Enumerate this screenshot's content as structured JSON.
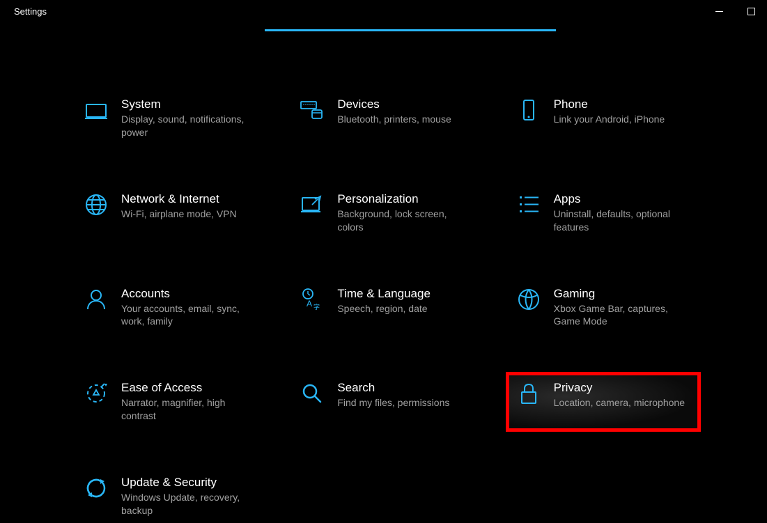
{
  "window": {
    "title": "Settings"
  },
  "accentColor": "#29b6f6",
  "highlightColor": "#ff0000",
  "categories": [
    {
      "icon": "system",
      "title": "System",
      "desc": "Display, sound, notifications, power",
      "highlighted": false
    },
    {
      "icon": "devices",
      "title": "Devices",
      "desc": "Bluetooth, printers, mouse",
      "highlighted": false
    },
    {
      "icon": "phone",
      "title": "Phone",
      "desc": "Link your Android, iPhone",
      "highlighted": false
    },
    {
      "icon": "network",
      "title": "Network & Internet",
      "desc": "Wi-Fi, airplane mode, VPN",
      "highlighted": false
    },
    {
      "icon": "personalization",
      "title": "Personalization",
      "desc": "Background, lock screen, colors",
      "highlighted": false
    },
    {
      "icon": "apps",
      "title": "Apps",
      "desc": "Uninstall, defaults, optional features",
      "highlighted": false
    },
    {
      "icon": "accounts",
      "title": "Accounts",
      "desc": "Your accounts, email, sync, work, family",
      "highlighted": false
    },
    {
      "icon": "time",
      "title": "Time & Language",
      "desc": "Speech, region, date",
      "highlighted": false
    },
    {
      "icon": "gaming",
      "title": "Gaming",
      "desc": "Xbox Game Bar, captures, Game Mode",
      "highlighted": false
    },
    {
      "icon": "ease",
      "title": "Ease of Access",
      "desc": "Narrator, magnifier, high contrast",
      "highlighted": false
    },
    {
      "icon": "search",
      "title": "Search",
      "desc": "Find my files, permissions",
      "highlighted": false
    },
    {
      "icon": "privacy",
      "title": "Privacy",
      "desc": "Location, camera, microphone",
      "highlighted": true
    },
    {
      "icon": "update",
      "title": "Update & Security",
      "desc": "Windows Update, recovery, backup",
      "highlighted": false
    }
  ]
}
